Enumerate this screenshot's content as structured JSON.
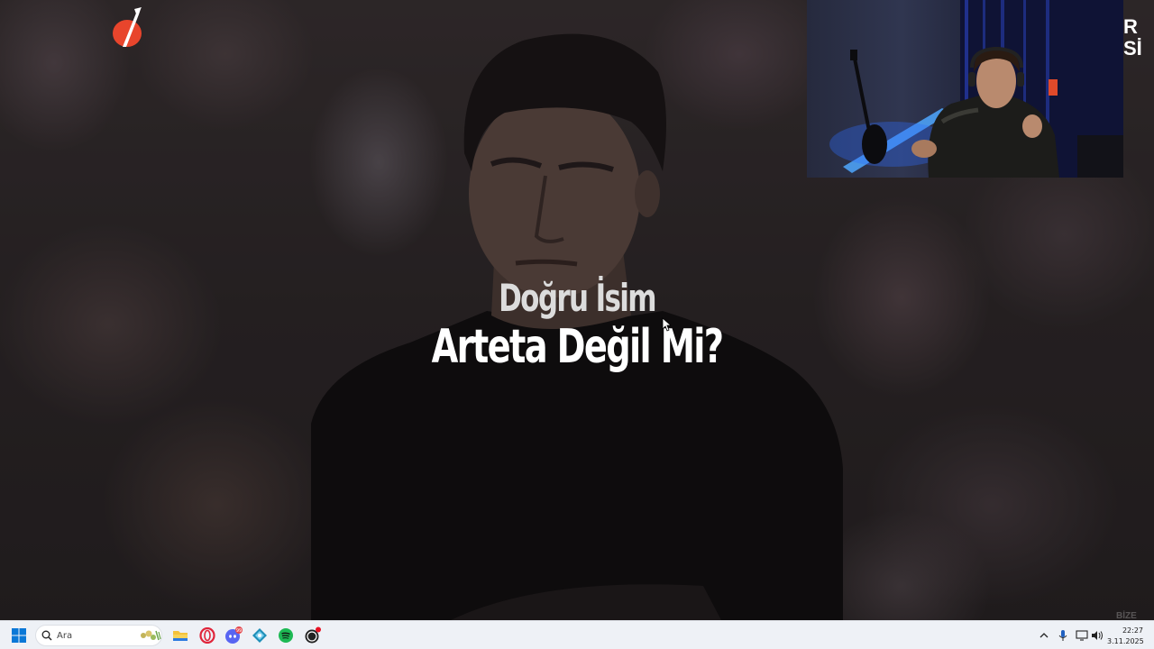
{
  "video": {
    "caption_line1": "Doğru İsim",
    "caption_line2": "Arteta Değil Mi?",
    "watermark": "BİZE"
  },
  "overlay": {
    "side_text": "R\nSİ"
  },
  "taskbar": {
    "search_placeholder": "Ara",
    "apps": [
      "file-explorer",
      "opera",
      "discord",
      "cube-app",
      "spotify",
      "obs"
    ],
    "discord_badge_color": "#e5484d",
    "clock_time": "22:27",
    "clock_date": "3.11.2025"
  },
  "colors": {
    "taskbar_bg": "#eef1f6",
    "logo_red": "#e8452c",
    "windows_blue": "#0a78d7",
    "spotify_green": "#1db954"
  }
}
